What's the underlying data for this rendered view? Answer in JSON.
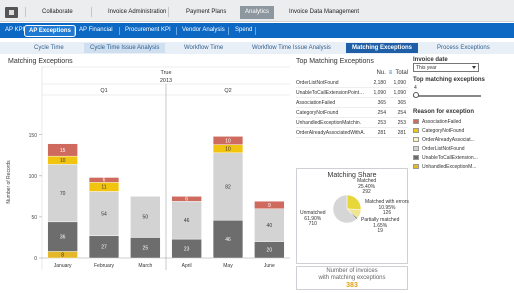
{
  "top_nav": {
    "items": [
      "Collaborate",
      "Invoice Administration",
      "Payment Plans",
      "Analytics",
      "Invoice Data Management"
    ],
    "active": "Analytics"
  },
  "sub_nav": {
    "items": [
      "AP KPI",
      "AP Exceptions",
      "AP Financial",
      "Procurement KPI",
      "Vendor Analysis",
      "Spend"
    ],
    "active": "AP Exceptions"
  },
  "tab_nav": {
    "items": [
      "Cycle Time",
      "Cycle Time Issue Analysis",
      "Workflow Time",
      "Workflow Time Issue Analysis",
      "Matching Exceptions",
      "Process Exceptions"
    ],
    "active": "Matching Exceptions"
  },
  "main": {
    "title": "Matching Exceptions"
  },
  "chart_data": {
    "type": "bar",
    "stacked": true,
    "header_row_1": "True",
    "header_row_2": "2013",
    "quarters": [
      "Q1",
      "Q2"
    ],
    "categories": [
      "January",
      "February",
      "March",
      "April",
      "May",
      "June"
    ],
    "ylabel": "Number of Records",
    "yticks": [
      0,
      50,
      100,
      150
    ],
    "ylim": [
      0,
      185
    ],
    "grid": false,
    "series": [
      {
        "name": "UnhandledExceptionMatching",
        "color": "#e5b82a",
        "values": [
          8,
          0,
          0,
          0,
          0,
          0
        ]
      },
      {
        "name": "UnableToCallExtensionPointTh.",
        "color": "#6d6d6d",
        "values": [
          36,
          27,
          25,
          23,
          46,
          20
        ]
      },
      {
        "name": "OrderListNotFound",
        "color": "#d3d3d3",
        "values": [
          70,
          54,
          50,
          46,
          82,
          40
        ]
      },
      {
        "name": "OrderAlreadyAssociatedWithA.",
        "color": "#fdf5c4",
        "values": [
          0,
          0,
          0,
          0,
          0,
          0
        ]
      },
      {
        "name": "CategoryNotFound",
        "color": "#f1c40f",
        "values": [
          10,
          11,
          0,
          0,
          10,
          0
        ]
      },
      {
        "name": "AssociationFailed",
        "color": "#cf6b5e",
        "values": [
          15,
          6,
          0,
          6,
          10,
          9
        ]
      }
    ]
  },
  "top_exceptions": {
    "title": "Top Matching Exceptions",
    "col_headers": [
      "Nu.",
      "Total"
    ],
    "rows": [
      {
        "name": "OrderListNotFound",
        "a": "2,180",
        "b": "1,090"
      },
      {
        "name": "UnableToCallExtensionPointTh.",
        "a": "1,090",
        "b": "1,090"
      },
      {
        "name": "AssociationFailed",
        "a": "365",
        "b": "365"
      },
      {
        "name": "CategoryNotFound",
        "a": "254",
        "b": "254"
      },
      {
        "name": "UnhandledExceptionMatchin.",
        "a": "253",
        "b": "253"
      },
      {
        "name": "OrderAlreadyAssociatedWithA.",
        "a": "281",
        "b": "281"
      }
    ]
  },
  "matching_share": {
    "title": "Matching Share",
    "labels": {
      "matched": [
        "Matched",
        "25.40%",
        "292"
      ],
      "matched_with_errors": [
        "Matched with errors",
        "10.95%",
        "126"
      ],
      "partially_matched": [
        "Partially matched",
        "1.65%",
        "19"
      ],
      "unmatched": [
        "Unmatched",
        "61.90%",
        "710"
      ]
    },
    "slices": [
      {
        "name": "Matched",
        "pct": 25.4,
        "color": "#e7d73a"
      },
      {
        "name": "Matched with errors",
        "pct": 10.95,
        "color": "#f2e592"
      },
      {
        "name": "Partially matched",
        "pct": 1.65,
        "color": "#6e6e6e"
      },
      {
        "name": "Unmatched",
        "pct": 61.9,
        "color": "#d6d6d6"
      }
    ]
  },
  "invoice_count": {
    "label_1": "Number of invoices",
    "label_2": "with matching exceptions",
    "value": "383"
  },
  "filters": {
    "invoice_date_title": "Invoice date",
    "invoice_date_value": "This year",
    "top_matching_title": "Top matching exceptions",
    "top_matching_value": "4",
    "top_matching_fraction": 0.0,
    "reason_title": "Reason for exception",
    "reasons": [
      {
        "name": "AssociationFailed",
        "color": "#cf6b5e"
      },
      {
        "name": "CategoryNotFound",
        "color": "#f1c40f"
      },
      {
        "name": "OrderAlreadyAssociat...",
        "color": "#fdf5c4"
      },
      {
        "name": "OrderListNotFound",
        "color": "#d3d3d3"
      },
      {
        "name": "UnableToCallExtension...",
        "color": "#6d6d6d"
      },
      {
        "name": "UnhandledExceptionM...",
        "color": "#e5b82a"
      }
    ]
  }
}
